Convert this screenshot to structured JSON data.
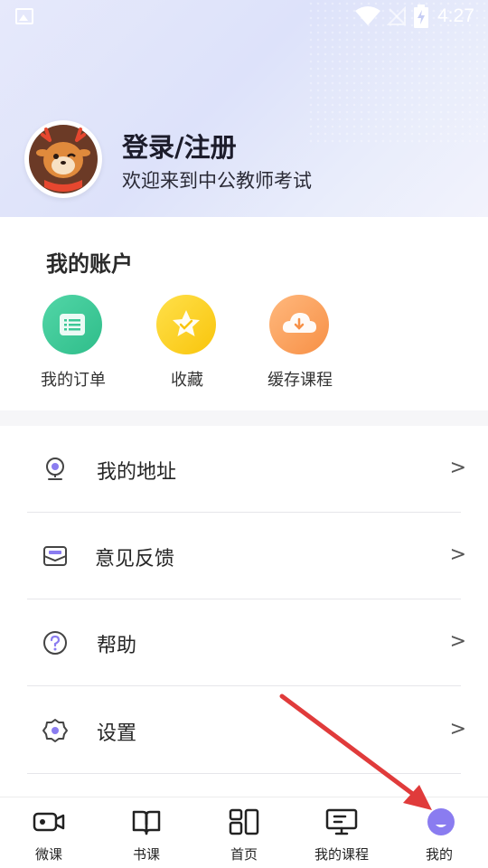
{
  "status_bar": {
    "time": "4:27",
    "icons": [
      "image-icon",
      "wifi-icon",
      "no-signal-icon",
      "battery-charging-icon"
    ]
  },
  "profile": {
    "login_title": "登录/注册",
    "welcome_text": "欢迎来到中公教师考试",
    "avatar_icon": "deer-mascot-avatar"
  },
  "account": {
    "title": "我的账户",
    "items": [
      {
        "label": "我的订单",
        "icon": "order-list-icon",
        "color": "#3cc896"
      },
      {
        "label": "收藏",
        "icon": "star-icon",
        "color": "#fbd22a"
      },
      {
        "label": "缓存课程",
        "icon": "cloud-download-icon",
        "color": "#f9a15e"
      }
    ]
  },
  "menu": {
    "items": [
      {
        "label": "我的地址",
        "icon": "location-pin-icon",
        "arrow": ">"
      },
      {
        "label": "意见反馈",
        "icon": "mail-feedback-icon",
        "arrow": ">"
      },
      {
        "label": "帮助",
        "icon": "help-question-icon",
        "arrow": ">"
      },
      {
        "label": "设置",
        "icon": "settings-gear-icon",
        "arrow": ">"
      }
    ]
  },
  "tabbar": {
    "tabs": [
      {
        "label": "微课",
        "icon": "video-camera-icon",
        "active": false
      },
      {
        "label": "书课",
        "icon": "book-icon",
        "active": false
      },
      {
        "label": "首页",
        "icon": "home-grid-icon",
        "active": false
      },
      {
        "label": "我的课程",
        "icon": "monitor-course-icon",
        "active": false
      },
      {
        "label": "我的",
        "icon": "profile-face-icon",
        "active": true
      }
    ],
    "active_color": "#8a7cf0"
  },
  "annotation": {
    "type": "red-arrow",
    "color": "#e03b3b"
  }
}
